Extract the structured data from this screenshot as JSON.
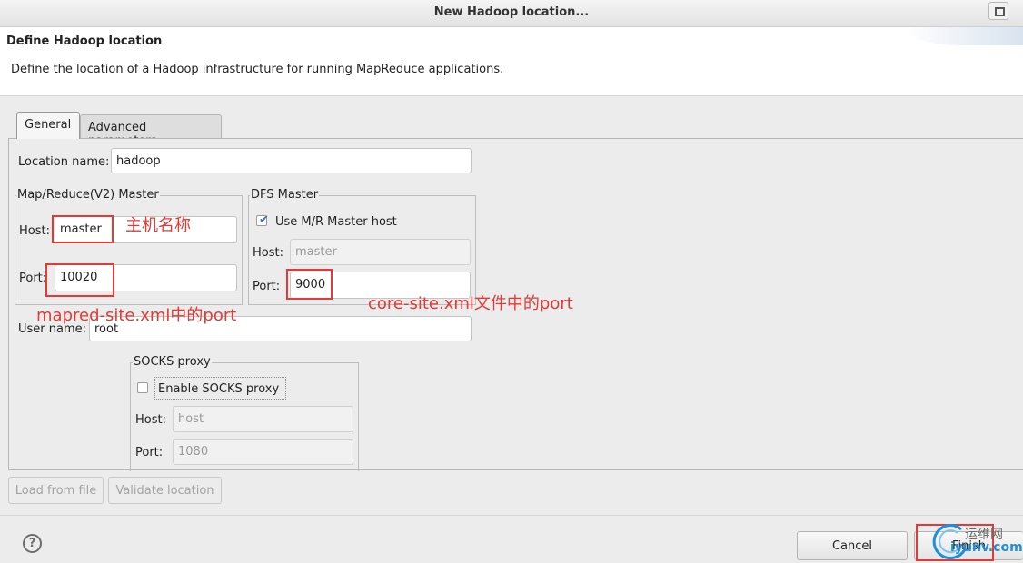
{
  "window": {
    "title": "New Hadoop location..."
  },
  "header": {
    "title": "Define Hadoop location",
    "description": "Define the location of a Hadoop infrastructure for running MapReduce applications."
  },
  "tabs": [
    {
      "label": "General",
      "active": true
    },
    {
      "label": "Advanced parameters",
      "active": false
    }
  ],
  "form": {
    "location_name": {
      "label": "Location name:",
      "value": "hadoop"
    },
    "mr_master": {
      "title": "Map/Reduce(V2) Master",
      "host_label": "Host:",
      "host_value": "master",
      "port_label": "Port:",
      "port_value": "10020"
    },
    "dfs_master": {
      "title": "DFS Master",
      "use_mr_host_label": "Use M/R Master host",
      "use_mr_host_checked": true,
      "host_label": "Host:",
      "host_value": "master",
      "port_label": "Port:",
      "port_value": "9000"
    },
    "user_name": {
      "label": "User name:",
      "value": "root"
    },
    "socks": {
      "title": "SOCKS proxy",
      "enable_label": "Enable SOCKS proxy",
      "enable_checked": false,
      "host_label": "Host:",
      "host_value": "host",
      "port_label": "Port:",
      "port_value": "1080"
    }
  },
  "buttons": {
    "load_from_file": "Load from file",
    "validate_location": "Validate location",
    "help": "?",
    "cancel": "Cancel",
    "finish": "Finish"
  },
  "annotations": {
    "host_note": "主机名称",
    "mapred_note": "mapred-site.xml中的port",
    "core_note": "core-site.xml文件中的port"
  },
  "watermark": {
    "line1": "运维网",
    "line2": "iyunv.com"
  },
  "colors": {
    "annotation_red": "#e53935",
    "check_blue": "#3a6db5"
  }
}
